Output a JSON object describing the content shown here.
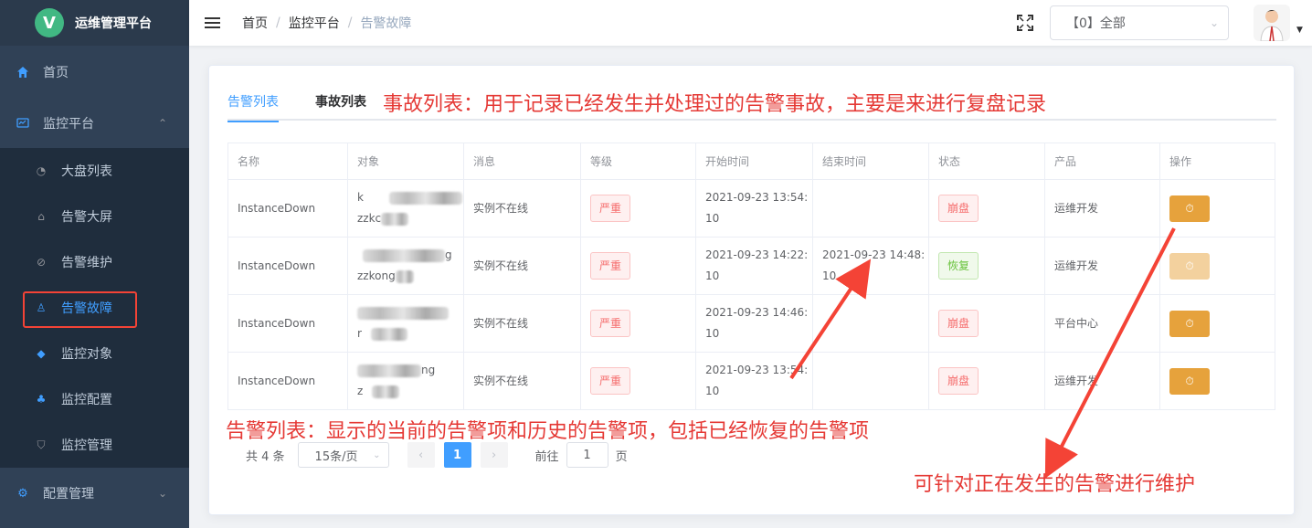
{
  "brand": {
    "logo_letter": "V",
    "title": "运维管理平台"
  },
  "sidebar": {
    "home": "首页",
    "monitor_group": "监控平台",
    "sub_items": [
      "大盘列表",
      "告警大屏",
      "告警维护",
      "告警故障",
      "监控对象",
      "监控配置",
      "监控管理"
    ],
    "config_group": "配置管理"
  },
  "header": {
    "breadcrumb": [
      "首页",
      "监控平台",
      "告警故障"
    ],
    "select_value": "【0】全部"
  },
  "tabs": {
    "alert_list": "告警列表",
    "incident_list": "事故列表"
  },
  "annotations": {
    "incident_note": "事故列表：用于记录已经发生并处理过的告警事故，主要是来进行复盘记录",
    "alert_note": "告警列表：显示的当前的告警项和历史的告警项，包括已经恢复的告警项",
    "maintain_note": "可针对正在发生的告警进行维护"
  },
  "table": {
    "columns": [
      "名称",
      "对象",
      "消息",
      "等级",
      "开始时间",
      "结束时间",
      "状态",
      "产品",
      "操作"
    ],
    "rows": [
      {
        "name": "InstanceDown",
        "obj1": "k",
        "obj2": "zzkc",
        "message": "实例不在线",
        "level": "严重",
        "start1": "2021-09-23 13:54:",
        "start2": "10",
        "end1": "",
        "end2": "",
        "status": "崩盘",
        "product": "运维开发"
      },
      {
        "name": "InstanceDown",
        "obj1": "g",
        "obj2": "zzkong",
        "message": "实例不在线",
        "level": "严重",
        "start1": "2021-09-23 14:22:",
        "start2": "10",
        "end1": "2021-09-23 14:48:",
        "end2": "10",
        "status": "恢复",
        "product": "运维开发"
      },
      {
        "name": "InstanceDown",
        "obj1": "",
        "obj2": "r",
        "message": "实例不在线",
        "level": "严重",
        "start1": "2021-09-23 14:46:",
        "start2": "10",
        "end1": "",
        "end2": "",
        "status": "崩盘",
        "product": "平台中心"
      },
      {
        "name": "InstanceDown",
        "obj1": "ng",
        "obj2": "z",
        "message": "实例不在线",
        "level": "严重",
        "start1": "2021-09-23 13:54:",
        "start2": "10",
        "end1": "",
        "end2": "",
        "status": "崩盘",
        "product": "运维开发"
      }
    ]
  },
  "pagination": {
    "total": "共 4 条",
    "page_size": "15条/页",
    "current": "1",
    "goto_label": "前往",
    "goto_value": "1",
    "page_suffix": "页"
  },
  "colors": {
    "accent": "#409eff",
    "danger": "#f56c6c",
    "warning": "#e6a23c",
    "success": "#67c23a",
    "annotation": "#e53935"
  }
}
